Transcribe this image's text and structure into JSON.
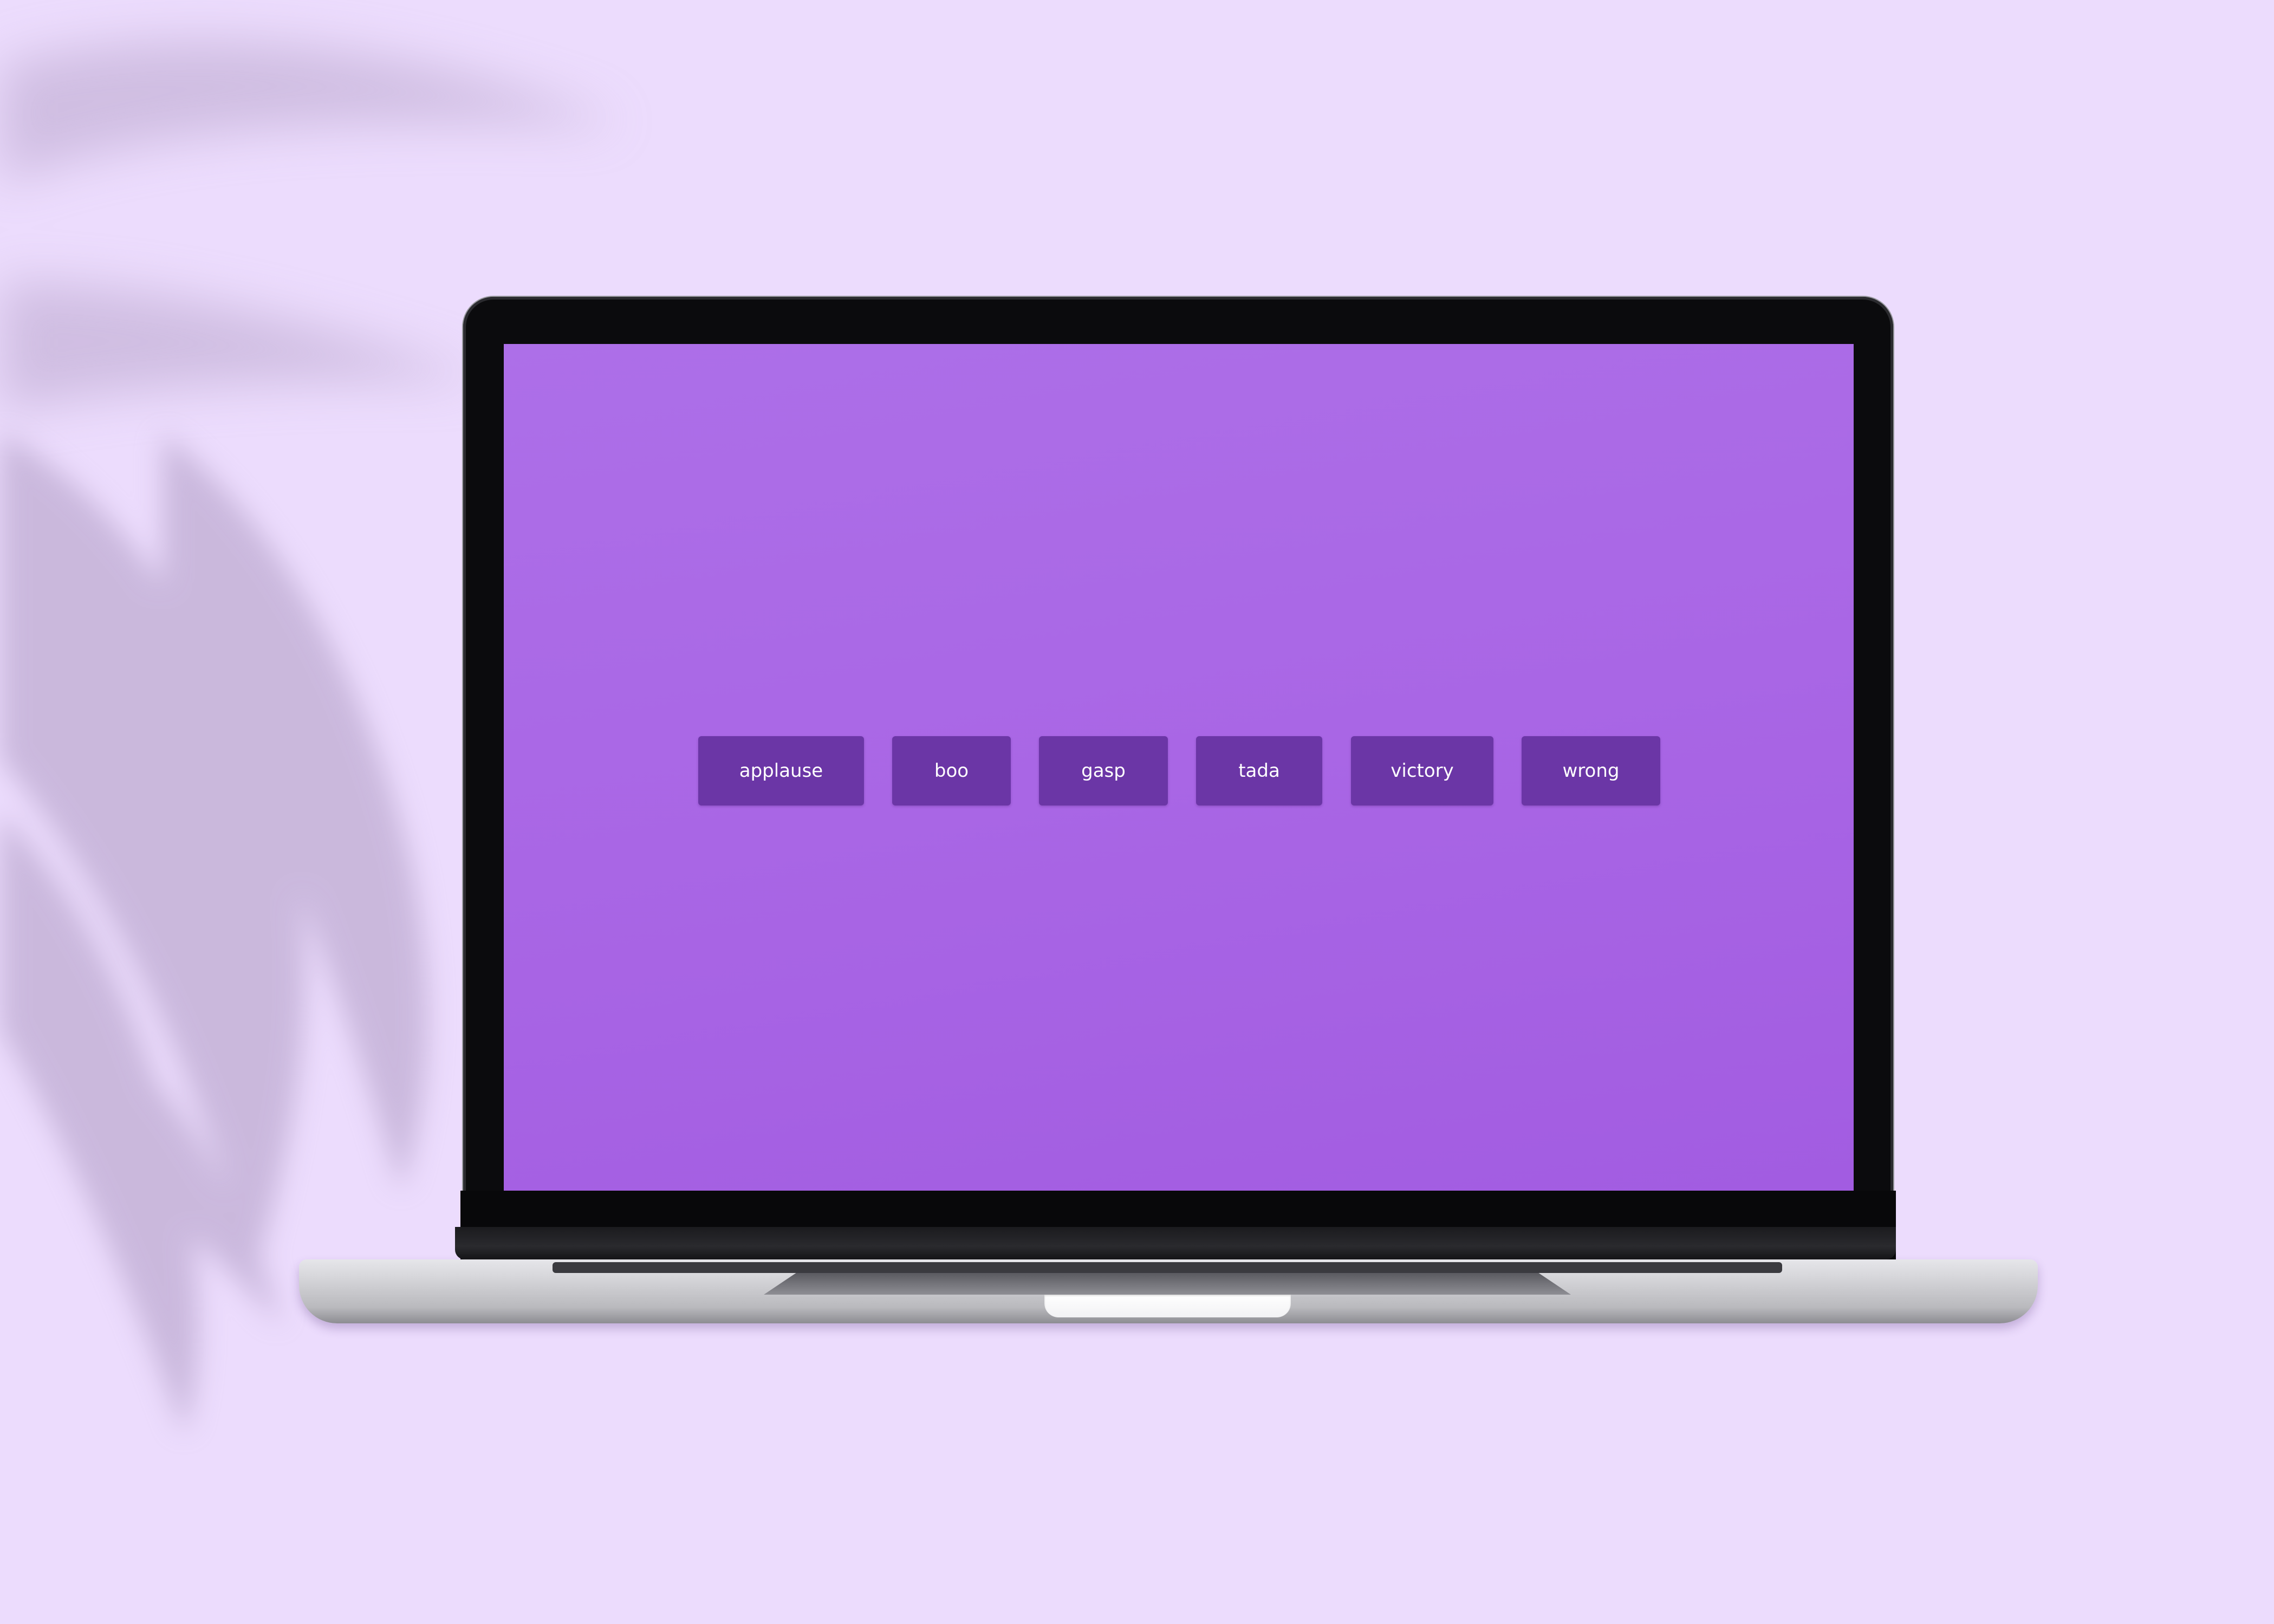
{
  "colors": {
    "background": "#ecdcfd",
    "screen": "#a966e5",
    "button": "#6b36a6",
    "button_text": "#ffffff"
  },
  "sound_buttons": [
    {
      "label": "applause"
    },
    {
      "label": "boo"
    },
    {
      "label": "gasp"
    },
    {
      "label": "tada"
    },
    {
      "label": "victory"
    },
    {
      "label": "wrong"
    }
  ]
}
